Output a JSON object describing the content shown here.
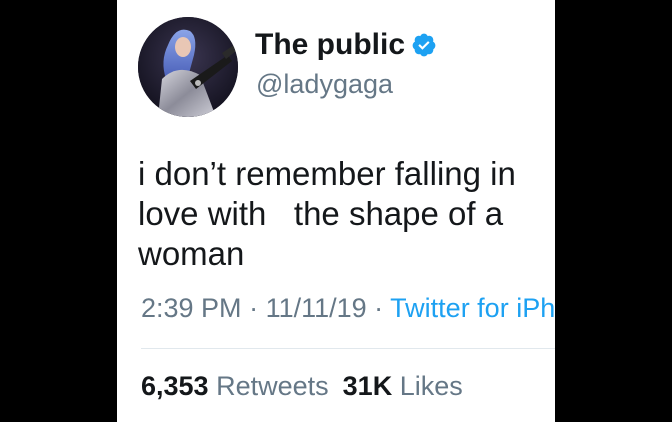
{
  "tweet": {
    "display_name": "The public",
    "handle": "@ladygaga",
    "verified_icon": "verified-badge-icon",
    "avatar_icon": "profile-photo",
    "text_line1": "i don’t remember falling in",
    "text_line2": "love with   the shape of a",
    "text_line3": "woman",
    "time": "2:39 PM",
    "separator1": " · ",
    "date": "11/11/19",
    "separator2": " · ",
    "source": "Twitter for iPh",
    "retweets_count": "6,353",
    "retweets_label": "Retweets",
    "likes_count": "31K",
    "likes_label": "Likes"
  },
  "colors": {
    "background_outer": "#000000",
    "card": "#ffffff",
    "text_primary": "#14171a",
    "text_secondary": "#657786",
    "link": "#1da1f2",
    "verified": "#1da1f2",
    "divider": "#e1e8ed"
  }
}
